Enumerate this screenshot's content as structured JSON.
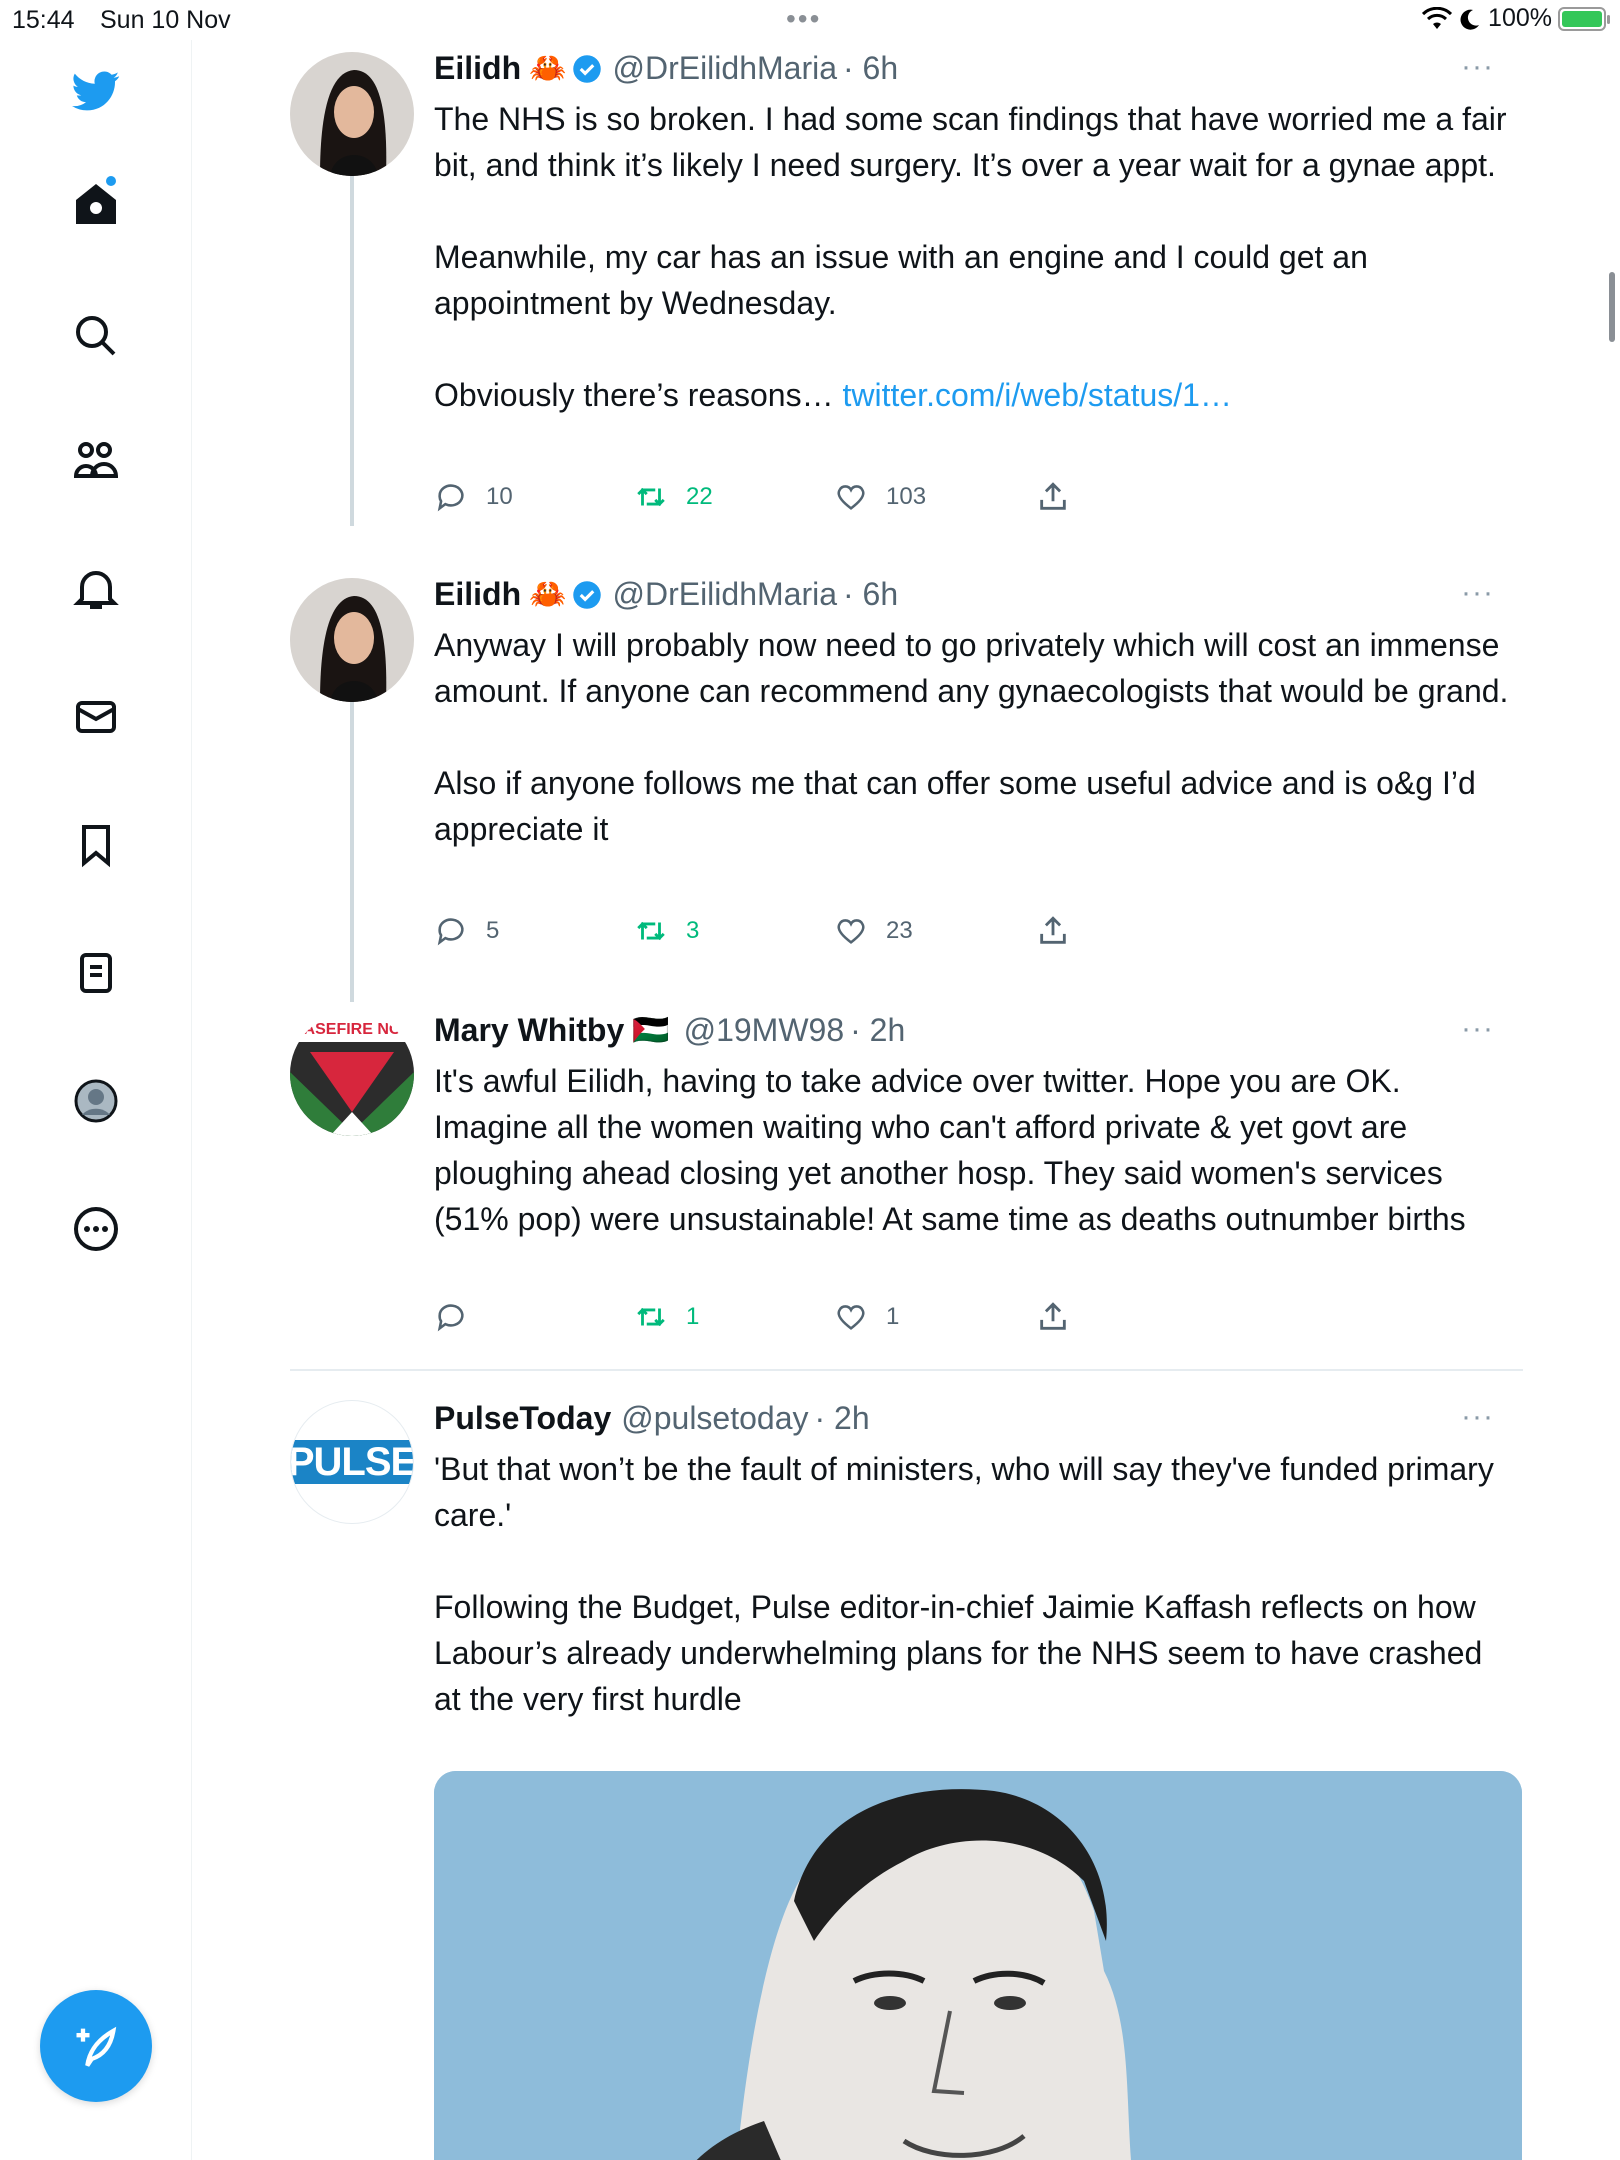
{
  "status_bar": {
    "time": "15:44",
    "date": "Sun 10 Nov",
    "battery": "100%"
  },
  "nav": {
    "items": [
      "Home",
      "Search",
      "Communities",
      "Notifications",
      "Messages",
      "Bookmarks",
      "Lists",
      "Profile",
      "More"
    ],
    "compose": "Tweet"
  },
  "colors": {
    "accent": "#1d9bf0",
    "retweet": "#00ba7c",
    "muted": "#536471"
  },
  "tweets": [
    {
      "name": "Eilidh",
      "emoji": "🦀",
      "handle": "@DrEilidhMaria",
      "time": "· 6h",
      "body": [
        "The NHS is so broken. I had some scan findings that have worried me a fair bit, and think it’s likely I need surgery. It’s over a year wait for a gynae appt.",
        "",
        "Meanwhile, my car has an issue with an engine and I could get an appointment by Wednesday.",
        ""
      ],
      "last_line": "Obviously there’s reasons… ",
      "link": "twitter.com/i/web/status/1…",
      "replies": "10",
      "retweets": "22",
      "likes": "103"
    },
    {
      "name": "Eilidh",
      "emoji": "🦀",
      "handle": "@DrEilidhMaria",
      "time": "· 6h",
      "body": [
        "Anyway I will probably now need to go privately which will cost an immense amount. If anyone can recommend any gynaecologists that would be grand.",
        "",
        "Also if anyone follows me that can offer some useful advice and is o&g I’d appreciate it"
      ],
      "replies": "5",
      "retweets": "3",
      "likes": "23"
    },
    {
      "name": "Mary Whitby",
      "emoji": "🇵🇸",
      "handle": "@19MW98",
      "time": "· 2h",
      "avatar_text": "ASEFIRE NC",
      "body": [
        "It's awful Eilidh, having to take advice over twitter. Hope you are OK. Imagine all the women waiting who can't afford private & yet govt are ploughing ahead closing yet another hosp. They said women's services (51% pop) were unsustainable! At same time as deaths outnumber births"
      ],
      "replies": "",
      "retweets": "1",
      "likes": "1"
    },
    {
      "name": "PulseToday",
      "handle": "@pulsetoday",
      "time": "· 2h",
      "avatar_text": "PULSE",
      "body": [
        "'But that won’t be the fault of ministers, who will say they've funded primary care.'",
        "",
        "Following the Budget, Pulse editor-in-chief Jaimie Kaffash reflects on how Labour’s already underwhelming plans for the NHS seem to have crashed at the very first hurdle"
      ]
    }
  ],
  "more_glyph": "···"
}
